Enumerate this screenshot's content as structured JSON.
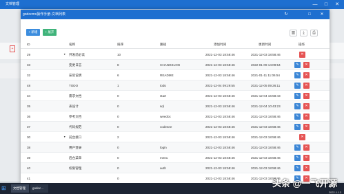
{
  "outer": {
    "title": "文档管理"
  },
  "modal": {
    "title": "godocms操作手册-文档列表",
    "add_label": "+ 新增",
    "expand_label": "+ 展开"
  },
  "columns": [
    "ID",
    "名称",
    "排序",
    "路径",
    "添加时间",
    "更新时间",
    "操作"
  ],
  "rows": [
    {
      "id": "29",
      "name": "开发前必读",
      "sort": "10",
      "path": "",
      "created": "2021-12-03 18:58:46",
      "updated": "2021-12-03 18:58:46",
      "caret": "▼",
      "level": 0
    },
    {
      "id": "33",
      "name": "变更日志",
      "sort": "8",
      "path": "CHANGELOG",
      "created": "2021-12-03 18:58:46",
      "updated": "2022-01-09 14:09:54",
      "caret": "",
      "level": 1
    },
    {
      "id": "32",
      "name": "安装说明",
      "sort": "6",
      "path": "README",
      "created": "2021-12-03 18:58:46",
      "updated": "2021-01-11 11:06:54",
      "caret": "",
      "level": 1
    },
    {
      "id": "48",
      "name": "TODO",
      "sort": "1",
      "path": "todo",
      "created": "2021-12-04 09:29:55",
      "updated": "2021-12-05 09:26:11",
      "caret": "",
      "level": 1
    },
    {
      "id": "34",
      "name": "需求文档",
      "sort": "0",
      "path": "start",
      "created": "2021-12-03 18:58:46",
      "updated": "2021-12-04 16:58:43",
      "caret": "",
      "level": 1
    },
    {
      "id": "35",
      "name": "表设计",
      "sort": "0",
      "path": "sql",
      "created": "2021-12-03 18:58:46",
      "updated": "2021-12-04 10:43:23",
      "caret": "",
      "level": 1
    },
    {
      "id": "36",
      "name": "参考文档",
      "sort": "0",
      "path": "weedoc",
      "created": "2021-12-03 18:58:46",
      "updated": "2021-12-03 18:58:46",
      "caret": "",
      "level": 1
    },
    {
      "id": "37",
      "name": "代码规范",
      "sort": "0",
      "path": "codesee",
      "created": "2021-12-03 18:58:46",
      "updated": "2021-12-03 18:58:46",
      "caret": "",
      "level": 1
    },
    {
      "id": "30",
      "name": "前台接口",
      "sort": "2",
      "path": "",
      "created": "2021-12-03 18:58:46",
      "updated": "2021-12-03 18:58:46",
      "caret": "▼",
      "level": 0
    },
    {
      "id": "38",
      "name": "用户登录",
      "sort": "0",
      "path": "login",
      "created": "2021-12-03 18:58:46",
      "updated": "2021-12-03 18:58:46",
      "caret": "",
      "level": 1
    },
    {
      "id": "39",
      "name": "后台菜单",
      "sort": "0",
      "path": "menu",
      "created": "2021-12-03 18:58:46",
      "updated": "2021-12-03 18:58:46",
      "caret": "",
      "level": 1
    },
    {
      "id": "40",
      "name": "权限管理",
      "sort": "0",
      "path": "auth",
      "created": "2021-12-03 18:58:46",
      "updated": "2021-12-03 18:58:46",
      "caret": "",
      "level": 1
    },
    {
      "id": "41",
      "name": "",
      "sort": "0",
      "path": "",
      "created": "2021-12-03 18:58:46",
      "updated": "2021-12-03 18:58:46",
      "caret": "",
      "level": 1
    }
  ],
  "taskbar": {
    "items": [
      "文档管理",
      "godoc..."
    ],
    "clock": "2022-1-13"
  },
  "watermark": "头条 @一飞开源",
  "colors": {
    "primary": "#1e6fd0",
    "add": "#3c8dde",
    "expand": "#3fb37a",
    "edit": "#3b86d6",
    "delete": "#e55353"
  }
}
